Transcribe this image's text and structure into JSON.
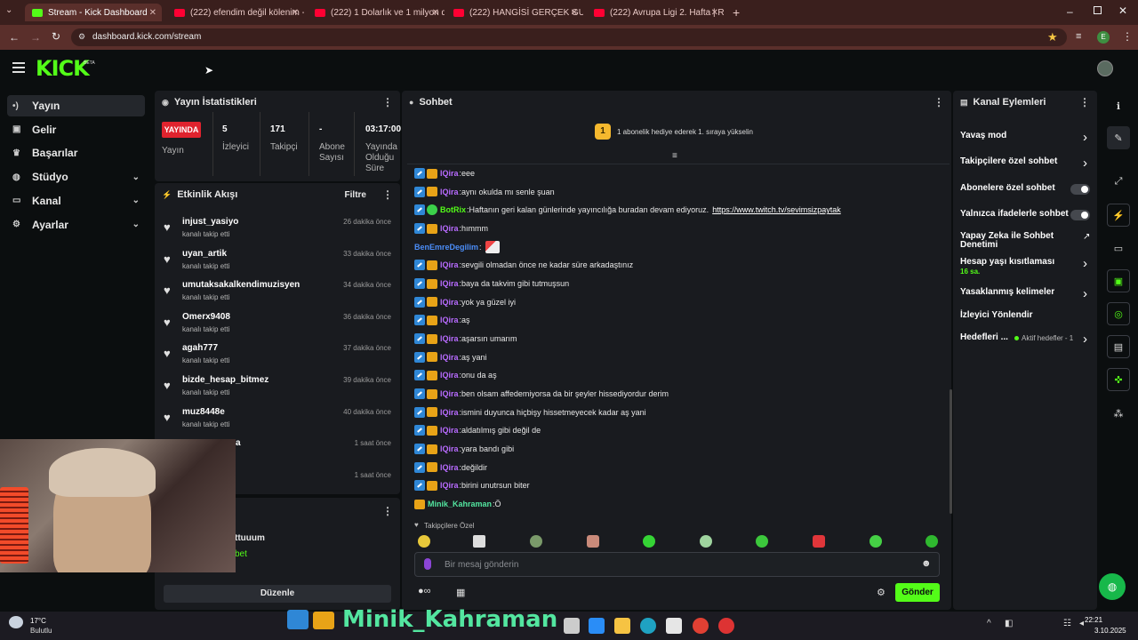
{
  "browser": {
    "tabs": [
      {
        "title": "Stream - Kick Dashboard",
        "active": true,
        "color": "#53fc18"
      },
      {
        "title": "(222) efendim değil kölenim - Y",
        "active": false,
        "color": "#ff0033"
      },
      {
        "title": "(222) 1 Dolarlık ve 1 milyon do",
        "active": false,
        "color": "#ff0033"
      },
      {
        "title": "(222) HANGİSİ GERÇEK GURBE",
        "active": false,
        "color": "#ff0033"
      },
      {
        "title": "(222) Avrupa Ligi 2. Hafta | Ron",
        "active": false,
        "color": "#ff0033"
      }
    ],
    "new_tab": "+",
    "url": "dashboard.kick.com/stream",
    "profile_letter": "E"
  },
  "app": {
    "logo": "KICK",
    "beta": "BETA",
    "accent": "#53fc18"
  },
  "sidebar": {
    "items": [
      {
        "label": "Yayın",
        "icon": "broadcast-icon",
        "active": true,
        "chevron": false
      },
      {
        "label": "Gelir",
        "icon": "revenue-icon",
        "active": false,
        "chevron": false
      },
      {
        "label": "Başarılar",
        "icon": "trophy-icon",
        "active": false,
        "chevron": false
      },
      {
        "label": "Stüdyo",
        "icon": "studio-icon",
        "active": false,
        "chevron": true
      },
      {
        "label": "Kanal",
        "icon": "channel-icon",
        "active": false,
        "chevron": true
      },
      {
        "label": "Ayarlar",
        "icon": "gear-icon",
        "active": false,
        "chevron": true
      }
    ]
  },
  "stats": {
    "title": "Yayın İstatistikleri",
    "live_badge": "YAYINDA",
    "items": [
      {
        "value": "",
        "label": "Yayın"
      },
      {
        "value": "5",
        "label": "İzleyici"
      },
      {
        "value": "171",
        "label": "Takipçi"
      },
      {
        "value": "-",
        "label": "Abone Sayısı"
      },
      {
        "value": "03:17:00",
        "label": "Yayında Olduğu Süre"
      }
    ]
  },
  "activity": {
    "title": "Etkinlik Akışı",
    "filter": "Filtre",
    "events": [
      {
        "name": "injust_yasiyo",
        "sub": "kanalı takip etti",
        "time": "26 dakika önce"
      },
      {
        "name": "uyan_artik",
        "sub": "kanalı takip etti",
        "time": "33 dakika önce"
      },
      {
        "name": "umutaksakalkendimuzisyen",
        "sub": "kanalı takip etti",
        "time": "34 dakika önce"
      },
      {
        "name": "Omerx9408",
        "sub": "kanalı takip etti",
        "time": "36 dakika önce"
      },
      {
        "name": "agah777",
        "sub": "kanalı takip etti",
        "time": "37 dakika önce"
      },
      {
        "name": "bizde_hesap_bitmez",
        "sub": "kanalı takip etti",
        "time": "39 dakika önce"
      },
      {
        "name": "muz8448e",
        "sub": "kanalı takip etti",
        "time": "40 dakika önce"
      },
      {
        "name": "a",
        "sub": "",
        "time": "1 saat önce"
      },
      {
        "name": "",
        "sub": "",
        "time": "1 saat önce"
      }
    ],
    "lower_text1": "ttuuum",
    "lower_text2": "bet",
    "edit_button": "Düzenle"
  },
  "chat": {
    "title": "Sohbet",
    "gift_rank": "1",
    "gift_text": "1 abonelik hediye ederek 1. sıraya yükselin",
    "messages": [
      {
        "user": "lQira",
        "text": "eee",
        "badges": "vip-crown",
        "color": "#b86bff"
      },
      {
        "user": "lQira",
        "text": "aynı okulda mı senle şuan",
        "badges": "vip-crown",
        "color": "#b86bff"
      },
      {
        "user": "BotRix",
        "text": "Haftanın geri kalan günlerinde yayıncılığa buradan devam ediyoruz.",
        "link": "https://www.twitch.tv/sevimsizpaytak",
        "badges": "vip-bot",
        "color": "#53fc18"
      },
      {
        "user": "lQira",
        "text": "hımmm",
        "badges": "vip-crown",
        "color": "#b86bff"
      },
      {
        "user": "BenEmreDegilim",
        "text": "",
        "badges": "none",
        "color": "#4b8df8"
      },
      {
        "user": "lQira",
        "text": "sevgili olmadan önce ne kadar süre arkadaştınız",
        "badges": "vip-crown",
        "color": "#b86bff"
      },
      {
        "user": "lQira",
        "text": "baya da takvim gibi tutmuşsun",
        "badges": "vip-crown",
        "color": "#b86bff"
      },
      {
        "user": "lQira",
        "text": "yok ya güzel iyi",
        "badges": "vip-crown",
        "color": "#b86bff"
      },
      {
        "user": "lQira",
        "text": "aş",
        "badges": "vip-crown",
        "color": "#b86bff"
      },
      {
        "user": "lQira",
        "text": "aşarsın umarım",
        "badges": "vip-crown",
        "color": "#b86bff"
      },
      {
        "user": "lQira",
        "text": "aş yani",
        "badges": "vip-crown",
        "color": "#b86bff"
      },
      {
        "user": "lQira",
        "text": "onu da aş",
        "badges": "vip-crown",
        "color": "#b86bff"
      },
      {
        "user": "lQira",
        "text": "ben olsam affedemiyorsa da bir şeyler hissediyordur derim",
        "badges": "vip-crown",
        "color": "#b86bff"
      },
      {
        "user": "lQira",
        "text": "ismini duyunca hiçbişy hissetmeyecek kadar aş yani",
        "badges": "vip-crown",
        "color": "#b86bff"
      },
      {
        "user": "lQira",
        "text": "aldatılmış gibi değil de",
        "badges": "vip-crown",
        "color": "#b86bff"
      },
      {
        "user": "lQira",
        "text": "yara bandı gibi",
        "badges": "vip-crown",
        "color": "#b86bff"
      },
      {
        "user": "lQira",
        "text": "değildir",
        "badges": "vip-crown",
        "color": "#b86bff"
      },
      {
        "user": "lQira",
        "text": "birini unutrsun biter",
        "badges": "vip-crown",
        "color": "#b86bff"
      },
      {
        "user": "Minik_Kahraman",
        "text": "Ö",
        "badges": "crown",
        "color": "#53e6a0"
      }
    ],
    "followers_only": "Takipçilere Özel",
    "input_placeholder": "Bir mesaj gönderin",
    "send_button": "Gönder"
  },
  "channel_actions": {
    "title": "Kanal Eylemleri",
    "items": [
      {
        "label": "Yavaş mod",
        "control": "chevron"
      },
      {
        "label": "Takipçilere özel sohbet",
        "control": "chevron"
      },
      {
        "label": "Abonelere özel sohbet",
        "control": "toggle"
      },
      {
        "label": "Yalnızca ifadelerle sohbet",
        "control": "toggle"
      },
      {
        "label": "Yapay Zeka ile Sohbet Denetimi",
        "control": "external"
      },
      {
        "label": "Hesap yaşı kısıtlaması",
        "sublabel": "16 sa.",
        "control": "chevron"
      },
      {
        "label": "Yasaklanmış kelimeler",
        "control": "chevron"
      },
      {
        "label": "İzleyici Yönlendir",
        "control": "none"
      },
      {
        "label": "Hedefleri ...",
        "sublabel": "Aktif hedefler - 1",
        "control": "chevron"
      }
    ]
  },
  "taskbar": {
    "weather_temp": "17°C",
    "weather_desc": "Bulutlu",
    "overlay_name": "Minik_Kahraman",
    "time": "22:21",
    "date": "3.10.2025"
  }
}
